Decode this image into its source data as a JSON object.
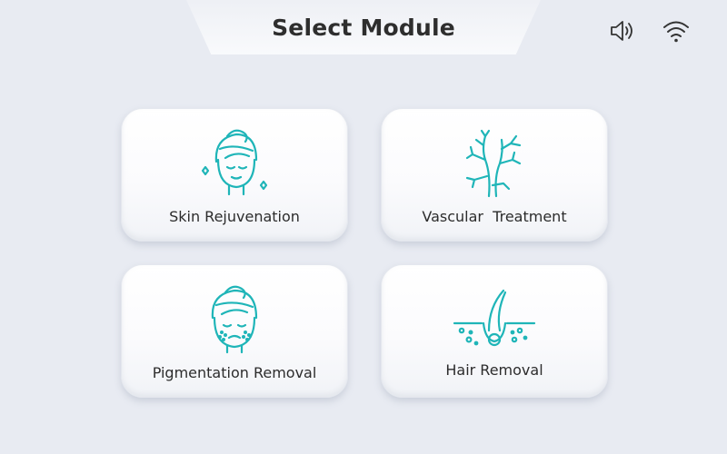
{
  "header": {
    "title": "Select Module"
  },
  "status_bar": {
    "icons": [
      "speaker-icon",
      "wifi-icon"
    ]
  },
  "modules": [
    {
      "label": "Skin Rejuvenation",
      "icon": "skin-rejuvenation-face-icon"
    },
    {
      "label": "Vascular  Treatment",
      "icon": "vascular-vessel-icon"
    },
    {
      "label": "Pigmentation Removal",
      "icon": "pigmentation-face-icon"
    },
    {
      "label": "Hair Removal",
      "icon": "hair-follicle-icon"
    }
  ],
  "colors": {
    "background": "#e8ebf2",
    "accent": "#1fb5b8",
    "card": "#ffffff",
    "text": "#2c2c2c"
  }
}
